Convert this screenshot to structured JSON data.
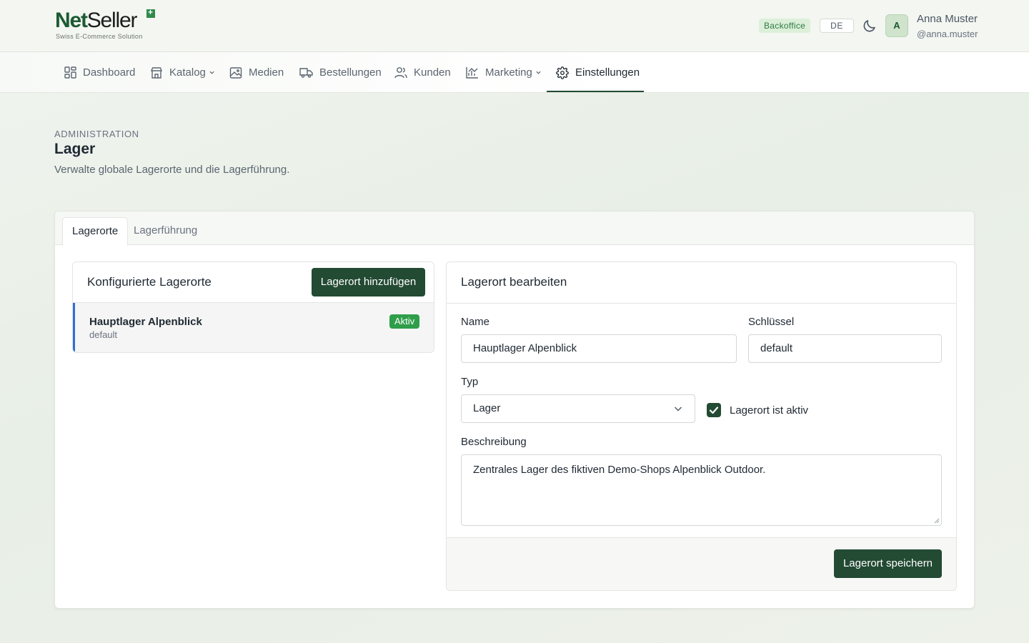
{
  "brand": {
    "logo_part1": "Net",
    "logo_part2": "Seller",
    "tagline": "Swiss E-Commerce Solution"
  },
  "header": {
    "badge": "Backoffice",
    "language": "DE",
    "theme_icon": "moon-icon",
    "avatar_initial": "A",
    "user_name": "Anna Muster",
    "user_handle": "@anna.muster"
  },
  "nav": {
    "items": [
      {
        "label": "Dashboard",
        "icon": "dashboard-grid-icon"
      },
      {
        "label": "Katalog",
        "icon": "store-icon",
        "has_dropdown": true
      },
      {
        "label": "Medien",
        "icon": "image-icon"
      },
      {
        "label": "Bestellungen",
        "icon": "truck-icon"
      },
      {
        "label": "Kunden",
        "icon": "users-icon"
      },
      {
        "label": "Marketing",
        "icon": "chart-icon",
        "has_dropdown": true
      },
      {
        "label": "Einstellungen",
        "icon": "gear-icon",
        "active": true
      }
    ]
  },
  "page": {
    "eyebrow": "ADMINISTRATION",
    "title": "Lager",
    "subtitle": "Verwalte globale Lagerorte und die Lagerführung."
  },
  "tabs": [
    {
      "label": "Lagerorte",
      "active": true
    },
    {
      "label": "Lagerführung",
      "active": false
    }
  ],
  "locations_panel": {
    "title": "Konfigurierte Lagerorte",
    "add_button": "Lagerort hinzufügen",
    "items": [
      {
        "name": "Hauptlager Alpenblick",
        "key": "default",
        "status": "Aktiv"
      }
    ]
  },
  "edit_panel": {
    "title": "Lagerort bearbeiten",
    "name_label": "Name",
    "name_value": "Hauptlager Alpenblick",
    "key_label": "Schlüssel",
    "key_value": "default",
    "type_label": "Typ",
    "type_value": "Lager",
    "active_label": "Lagerort ist aktiv",
    "active_checked": true,
    "description_label": "Beschreibung",
    "description_value": "Zentrales Lager des fiktiven Demo-Shops Alpenblick Outdoor.",
    "save_button": "Lagerort speichern"
  },
  "colors": {
    "primary": "#234a33",
    "active_tab_underline": "#234a33",
    "status_active": "#2f9e4a",
    "selected_border": "#2f6fd6"
  }
}
